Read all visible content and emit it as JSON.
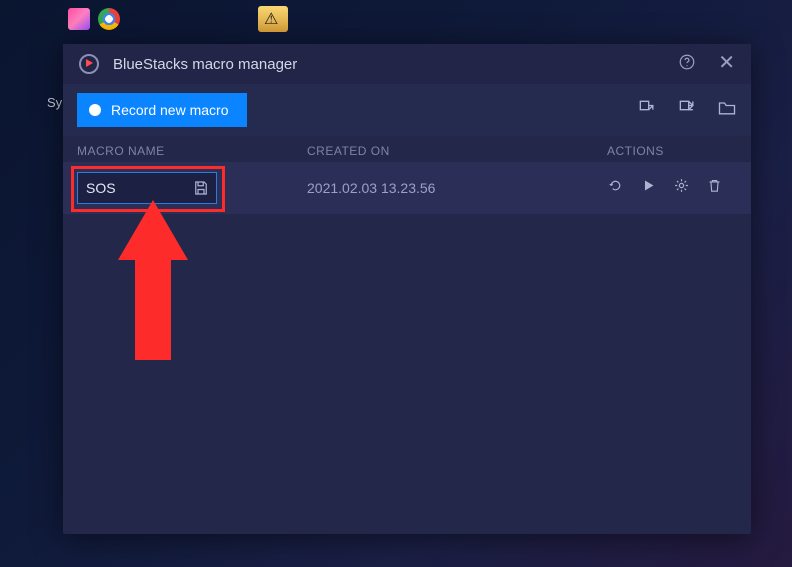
{
  "desktop": {
    "left_label": "Sy"
  },
  "window": {
    "title": "BlueStacks macro manager"
  },
  "toolbar": {
    "record_label": "Record new macro"
  },
  "columns": {
    "name": "MACRO NAME",
    "created": "CREATED ON",
    "actions": "ACTIONS"
  },
  "macro": {
    "name_value": "SOS",
    "created": "2021.02.03 13.23.56"
  }
}
